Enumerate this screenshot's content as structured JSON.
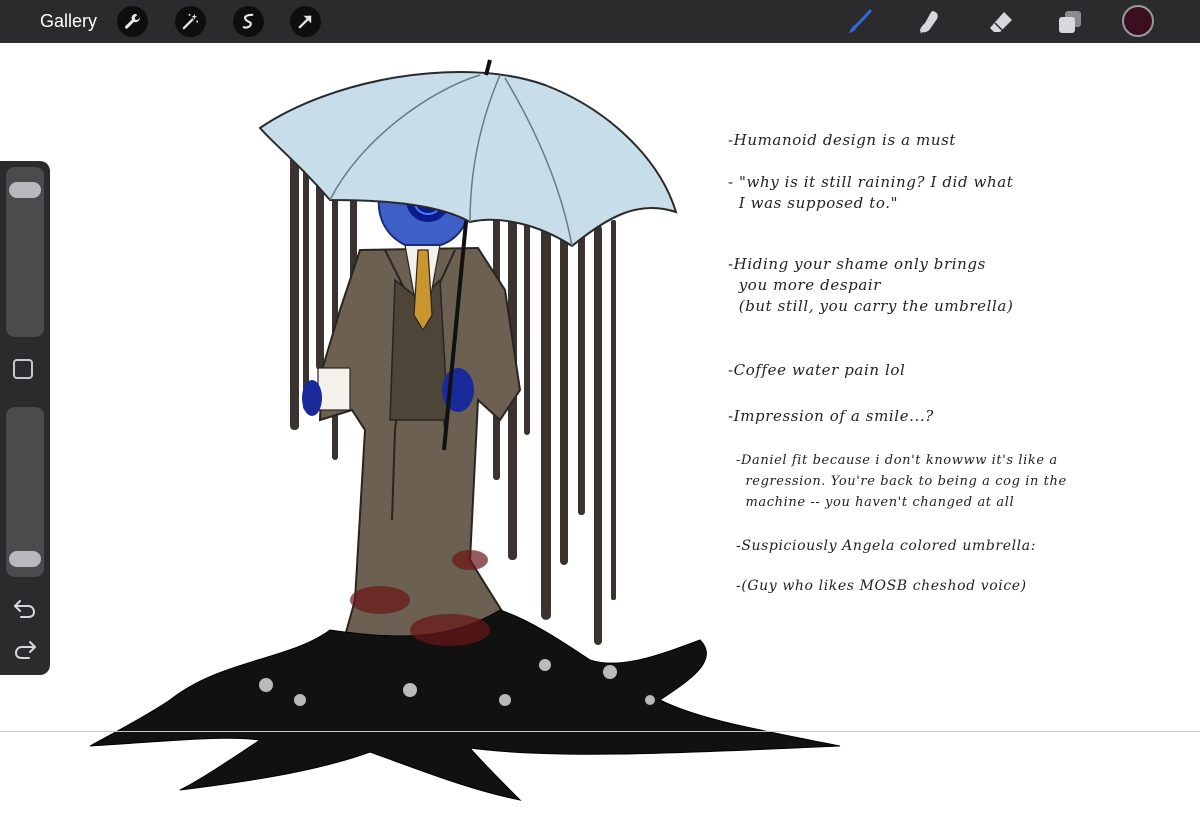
{
  "toolbar": {
    "gallery_label": "Gallery",
    "left_tools": [
      "wrench-icon",
      "magic-wand-icon",
      "selection-icon",
      "transform-arrow-icon"
    ],
    "right_tools": [
      "brush-icon",
      "smudge-icon",
      "eraser-icon",
      "layers-icon"
    ],
    "active_tool": "brush-icon",
    "accent_color": "#2d6bd6",
    "current_color": "#3a1020"
  },
  "sidebar": {
    "brush_size_level": 0.92,
    "opacity_level": 0.05
  },
  "notes": [
    "-Humanoid design is a must",
    "- \"why is it still raining? I did what\n  I was supposed to.\"",
    "-Hiding your shame only brings\n  you more despair\n  (but still, you carry the umbrella)",
    "-Coffee water pain lol",
    "-Impression of a smile...?",
    "-Daniel fit because i don't knowww it's like a\n  regression. You're back to being a cog in the\n  machine -- you haven't changed at all",
    "-Suspiciously Angela colored umbrella:",
    "-(Guy who likes MOSB cheshod voice)"
  ]
}
